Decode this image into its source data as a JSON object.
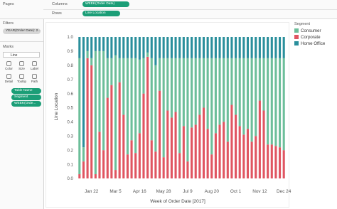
{
  "shelves": {
    "pages_label": "Pages",
    "columns_label": "Columns",
    "columns_pill": "WEEK(Order Date)",
    "rows_label": "Rows",
    "rows_pill": "Line Location"
  },
  "filters": {
    "title": "Filters",
    "items": [
      "YEAR(Order Date): 2..."
    ]
  },
  "marks": {
    "title": "Marks",
    "type": "Line",
    "buttons": [
      "Color",
      "Size",
      "Label",
      "Detail",
      "Tooltip",
      "Path"
    ],
    "pills": [
      "Table Name",
      "Segment",
      "WEEK(Orde..."
    ]
  },
  "legend": {
    "title": "Segment",
    "items": [
      {
        "label": "Consumer",
        "color": "#6cbe9a"
      },
      {
        "label": "Corporate",
        "color": "#e05561"
      },
      {
        "label": "Home Office",
        "color": "#2a8f9c"
      }
    ]
  },
  "chart_data": {
    "type": "bar",
    "stacked": true,
    "ylabel": "Line Location",
    "xlabel": "Week of Order Date [2017]",
    "ylim": [
      0,
      1.0
    ],
    "yticks": [
      "0.0",
      "0.1",
      "0.2",
      "0.3",
      "0.4",
      "0.5",
      "0.6",
      "0.7",
      "0.8",
      "0.9",
      "1.0"
    ],
    "xticks": [
      {
        "label": "Jan 22",
        "week": 3.5
      },
      {
        "label": "Mar 5",
        "week": 9.5
      },
      {
        "label": "Apr 16",
        "week": 15.5
      },
      {
        "label": "May 28",
        "week": 21.5
      },
      {
        "label": "Jul 9",
        "week": 27.5
      },
      {
        "label": "Aug 20",
        "week": 33.5
      },
      {
        "label": "Oct 1",
        "week": 39.5
      },
      {
        "label": "Nov 12",
        "week": 45.5
      },
      {
        "label": "Dec 24",
        "week": 51.5
      }
    ],
    "grid": false,
    "series": [
      {
        "name": "Corporate",
        "color": "#e05561",
        "values": [
          0.03,
          0.12,
          0.85,
          0.8,
          0.03,
          0.33,
          0.2,
          0.57,
          0.66,
          0.06,
          0.68,
          0.45,
          0.17,
          0.27,
          0.18,
          0.32,
          0.6,
          0.86,
          0.27,
          0.19,
          0.62,
          0.15,
          0.48,
          0.43,
          0.47,
          0.18,
          0.37,
          0.12,
          0.36,
          0.38,
          0.45,
          0.5,
          0.35,
          0.17,
          0.32,
          0.38,
          0.4,
          0.26,
          0.52,
          0.45,
          0.37,
          0.31,
          0.35,
          0.26,
          0.3,
          0.55,
          0.48,
          0.24,
          0.24,
          0.23,
          0.22,
          0.2
        ]
      },
      {
        "name": "Consumer",
        "color": "#6cbe9a",
        "values": [
          0.82,
          0.1,
          0.05,
          0.05,
          0.87,
          0.57,
          0.7,
          0.28,
          0.19,
          0.81,
          0.17,
          0.4,
          0.68,
          0.58,
          0.67,
          0.52,
          0.25,
          0.03,
          0.58,
          0.61,
          0.23,
          0.7,
          0.37,
          0.42,
          0.38,
          0.67,
          0.48,
          0.73,
          0.49,
          0.47,
          0.4,
          0.35,
          0.5,
          0.68,
          0.53,
          0.47,
          0.45,
          0.59,
          0.33,
          0.4,
          0.48,
          0.54,
          0.5,
          0.59,
          0.55,
          0.3,
          0.37,
          0.61,
          0.61,
          0.62,
          0.63,
          0.65
        ]
      },
      {
        "name": "Home Office",
        "color": "#2a8f9c",
        "values": [
          0.15,
          0.78,
          0.1,
          0.15,
          0.1,
          0.1,
          0.1,
          0.15,
          0.15,
          0.13,
          0.15,
          0.15,
          0.15,
          0.15,
          0.15,
          0.16,
          0.15,
          0.11,
          0.15,
          0.2,
          0.15,
          0.15,
          0.15,
          0.15,
          0.15,
          0.15,
          0.15,
          0.15,
          0.15,
          0.15,
          0.15,
          0.15,
          0.15,
          0.15,
          0.15,
          0.15,
          0.15,
          0.15,
          0.15,
          0.15,
          0.15,
          0.15,
          0.15,
          0.15,
          0.15,
          0.15,
          0.15,
          0.15,
          0.15,
          0.15,
          0.15,
          0.15
        ]
      }
    ]
  }
}
